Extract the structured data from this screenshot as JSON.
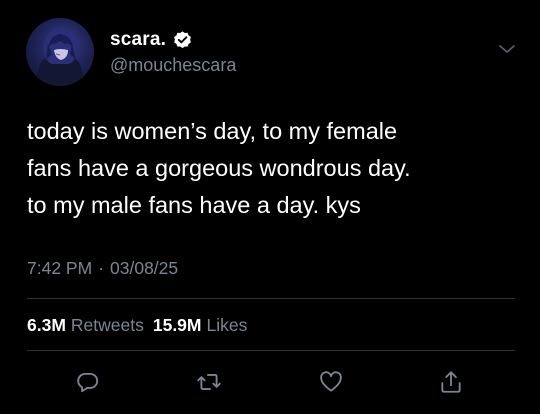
{
  "author": {
    "display_name": "scara.",
    "handle": "@mouchescara",
    "verified": true,
    "avatar_icon": "anime-character-avatar"
  },
  "tweet": {
    "text": "today is women’s day, to my female\nfans have a gorgeous wondrous day.\nto my male fans have a day. kys",
    "time": "7:42 PM",
    "separator": "·",
    "date": "03/08/25"
  },
  "stats": {
    "retweets_count": "6.3M",
    "retweets_label": "Retweets",
    "likes_count": "15.9M",
    "likes_label": "Likes"
  },
  "actions": {
    "reply_icon": "reply-icon",
    "retweet_icon": "retweet-icon",
    "like_icon": "heart-icon",
    "share_icon": "share-icon"
  },
  "colors": {
    "background": "#000000",
    "text_primary": "#ffffff",
    "text_secondary": "#7c8690",
    "divider": "#2f3336",
    "verified_badge": "#ffffff"
  }
}
